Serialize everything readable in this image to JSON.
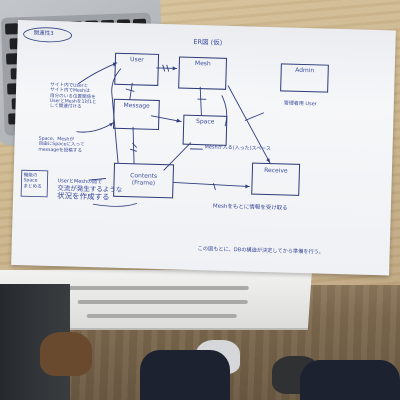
{
  "diagram": {
    "header_label": "関連性3",
    "title": "ER図 (仮)",
    "entities": {
      "user": "User",
      "mesh": "Mesh",
      "admin": "Admin",
      "message": "Message",
      "space": "Space",
      "contents": "Contents",
      "contents_sub": "(Frame)",
      "receive": "Receive"
    },
    "notes": {
      "user_note": [
        "サイト内でUserと",
        "サイト内でMeshは",
        "自分のいる位置関係を",
        "UserとMeshを1対1と",
        "して関連付ける"
      ],
      "space_note": [
        "Space、Meshが",
        "自由にSpaceに入って",
        "messageを投稿する"
      ],
      "boxed_note": [
        "機能の",
        "Space",
        "まとめる"
      ],
      "admin_note": "管理者用 User",
      "space_side_note": "Meshが入る(入った)スペース",
      "receive_note": "Meshをもとに情報を受け取る",
      "bottom_left_note": [
        "UserとMeshの間で",
        "交流が発生するような",
        "状況を作成する"
      ],
      "footer_note": "この図もとに、DBの構造が決定してから準備を行う。"
    }
  },
  "colors": {
    "ink": "#34479b",
    "paper": "#f6f7f9",
    "desk": "#cdb78e"
  }
}
